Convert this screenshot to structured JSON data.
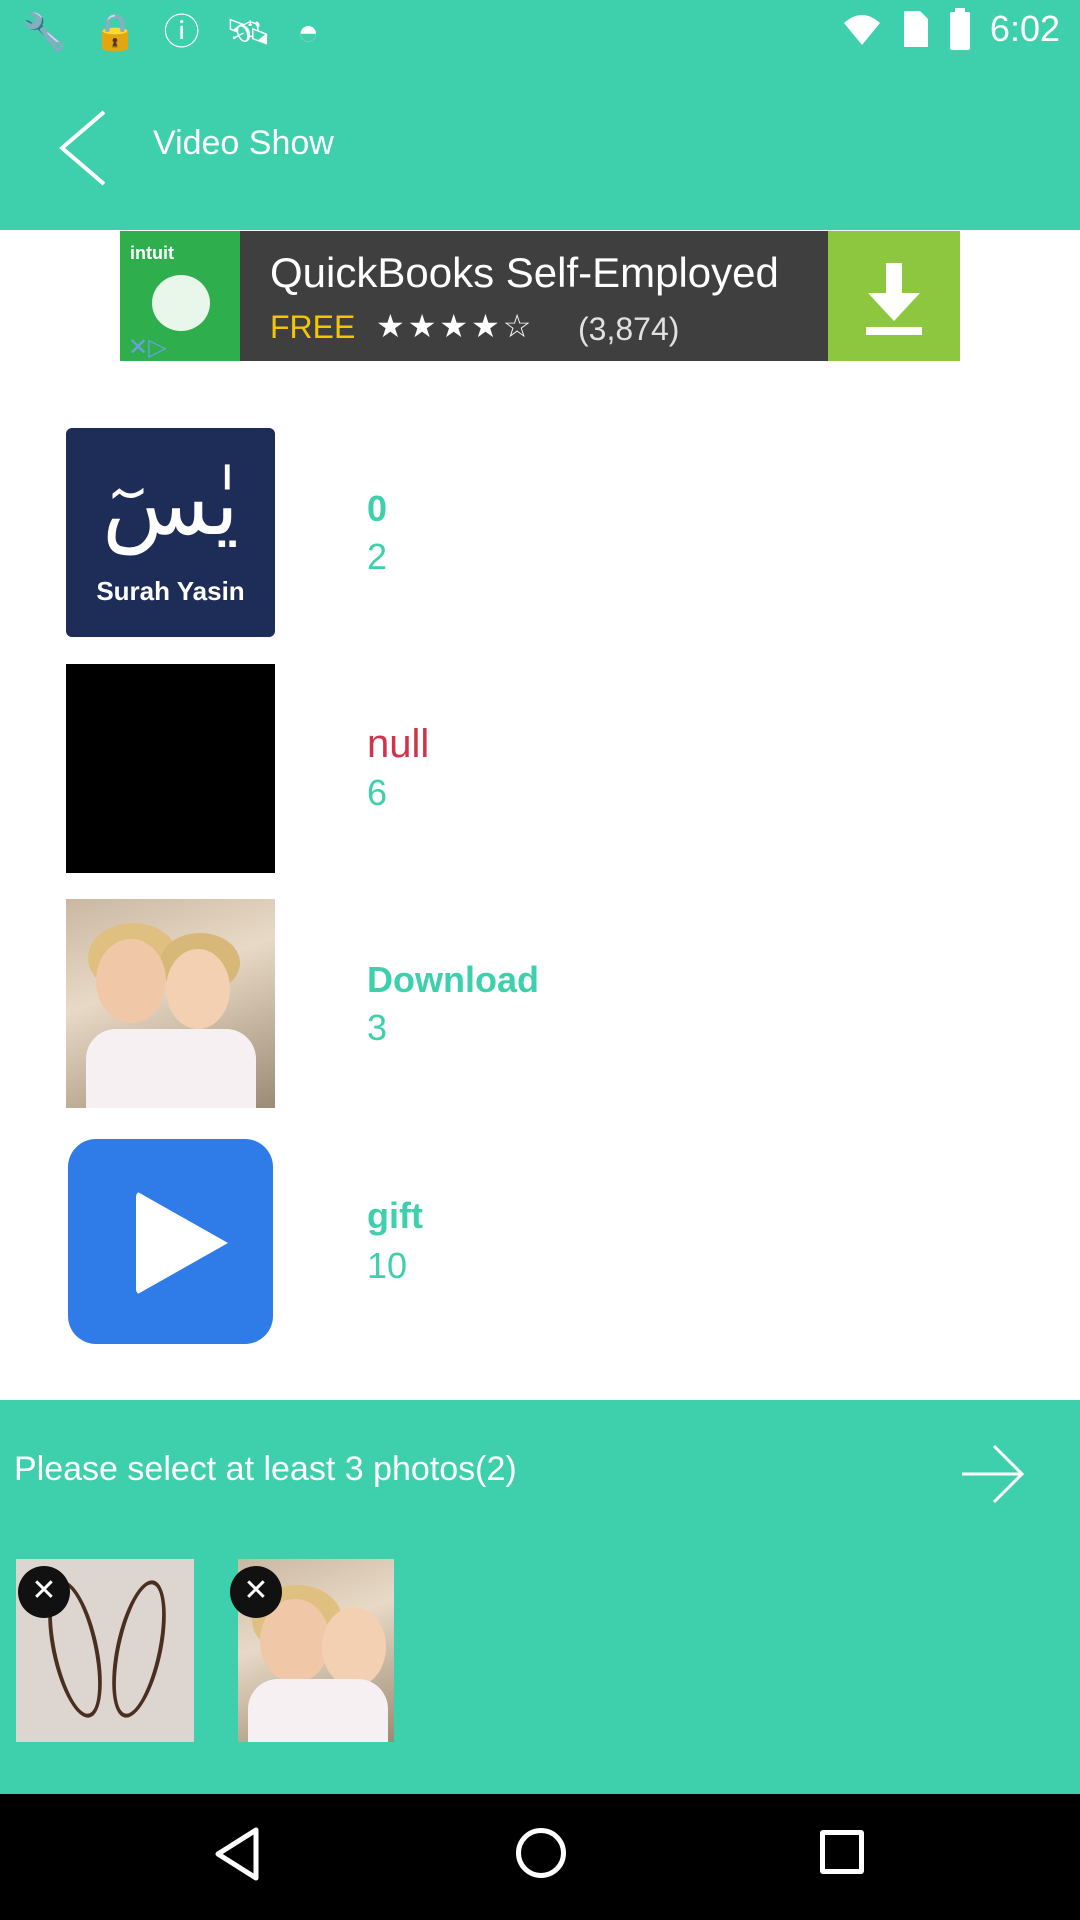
{
  "status_bar": {
    "time": "6:02",
    "icons": [
      "wrench-icon",
      "lock-icon",
      "info-icon",
      "satellite-icon",
      "android-icon",
      "wifi-icon",
      "sim-icon",
      "battery-icon"
    ]
  },
  "app_bar": {
    "title": "Video Show",
    "back_icon": "chevron-left-icon"
  },
  "ad": {
    "brand": "intuit",
    "title": "QuickBooks Self-Employed",
    "price": "FREE",
    "stars": "★★★★☆",
    "reviews": "(3,874)",
    "download_icon": "download-icon"
  },
  "albums": [
    {
      "thumb": "surah-yasin",
      "thumb_caption": "Surah Yasin",
      "thumb_arabic": "يٰسٓ",
      "title": "0",
      "count": "2"
    },
    {
      "thumb": "black",
      "title": "null",
      "count": "6"
    },
    {
      "thumb": "photo",
      "title": "Download",
      "count": "3"
    },
    {
      "thumb": "play",
      "title": "gift",
      "count": "10"
    }
  ],
  "selection": {
    "prompt": "Please select at least 3 photos(2)",
    "next_icon": "arrow-right-icon",
    "selected": [
      {
        "name": "henna-photo",
        "remove_icon": "close-icon"
      },
      {
        "name": "girls-photo",
        "remove_icon": "close-icon"
      }
    ]
  },
  "colors": {
    "accent": "#3ecfac",
    "null_title": "#d2334c"
  }
}
